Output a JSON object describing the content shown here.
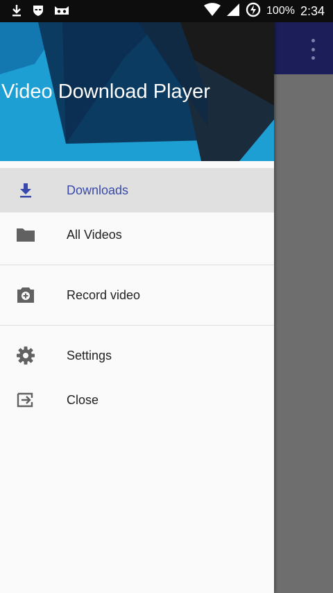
{
  "status_bar": {
    "battery_percent": "100%",
    "time": "2:34",
    "icons": [
      "download-icon",
      "privacy-mask-icon",
      "cyanogen-bot-icon",
      "wifi-icon",
      "cell-signal-icon",
      "battery-charging-icon"
    ]
  },
  "drawer": {
    "header_title": "Video Download Player",
    "items": [
      {
        "label": "Downloads",
        "icon": "download-icon",
        "active": true
      },
      {
        "label": "All Videos",
        "icon": "folder-icon",
        "active": false
      },
      {
        "label": "Record video",
        "icon": "camera-add-icon",
        "active": false
      },
      {
        "label": "Settings",
        "icon": "gear-icon",
        "active": false
      },
      {
        "label": "Close",
        "icon": "exit-icon",
        "active": false
      }
    ]
  },
  "colors": {
    "accent": "#3949ab",
    "app_bar": "#1b1e58",
    "header_bg": "#1e9fd3",
    "scrim": "#6e6e6e"
  }
}
